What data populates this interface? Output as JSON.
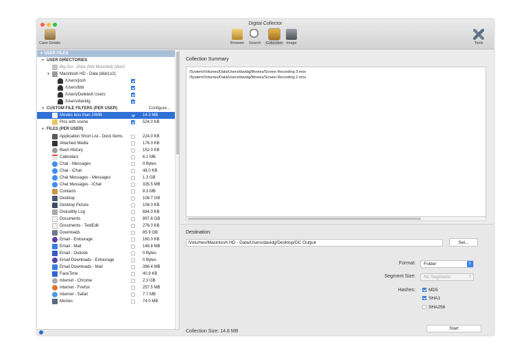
{
  "window": {
    "title": "Digital Collector"
  },
  "toolbar": {
    "case_details": "Case Details",
    "browser": "Browser",
    "search": "Search",
    "collection": "Collection",
    "image": "Image",
    "tools": "Tools"
  },
  "sidebar": {
    "user_files_header": "USER FILES",
    "user_directories": "USER DIRECTORIES",
    "big_sur": "Big Sur - Data (Not Mounted) (disk1",
    "macintosh_hd": "Macintosh HD - Data (disk1s2)",
    "dirs": [
      "/Users/josh",
      "/Users/bbt",
      "/Users/Deleted\\ Users",
      "/Users/davidg"
    ],
    "custom_filters": "CUSTOM FILE FILTERS (PER USER)",
    "configure": "Configure...",
    "filters": [
      {
        "name": "Movies less than 20MB",
        "size": "14.3 MB"
      },
      {
        "name": "Pics with scene",
        "size": "524.0 KB"
      }
    ],
    "files_per_user": "FILES (PER USER)",
    "files": [
      {
        "name": "Application Short List - Dock Items",
        "size": "224.0 KB"
      },
      {
        "name": "Attached Media",
        "size": "176.0 KB"
      },
      {
        "name": "Bash History",
        "size": "152.0 KB"
      },
      {
        "name": "Calendars",
        "size": "6.1 MB"
      },
      {
        "name": "Chat - Messages",
        "size": "0 Bytes"
      },
      {
        "name": "Chat - iChat",
        "size": "48.0 KB"
      },
      {
        "name": "Chat Messages - Messages",
        "size": "1.3 GB"
      },
      {
        "name": "Chat Messages - iChat",
        "size": "335.5 MB"
      },
      {
        "name": "Contacts",
        "size": "8.3 MB"
      },
      {
        "name": "Desktop",
        "size": "106.7 GB"
      },
      {
        "name": "Desktop Picture",
        "size": "108.0 KB"
      },
      {
        "name": "Diskutility Log",
        "size": "684.0 KB"
      },
      {
        "name": "Documents",
        "size": "897.6 GB"
      },
      {
        "name": "Documents - TextEdit",
        "size": "276.0 KB"
      },
      {
        "name": "Downloads",
        "size": "85.9 GB"
      },
      {
        "name": "Email - Entourage",
        "size": "160.0 KB"
      },
      {
        "name": "Email - Mail",
        "size": "148.6 MB"
      },
      {
        "name": "Email - Outlook",
        "size": "0 Bytes"
      },
      {
        "name": "Email Downloads - Entourage",
        "size": "0 Bytes"
      },
      {
        "name": "Email Downloads - Mail",
        "size": "396.4 MB"
      },
      {
        "name": "FaceTime",
        "size": "40.9 KB"
      },
      {
        "name": "Internet - Chrome",
        "size": "2.3 GB"
      },
      {
        "name": "Internet - Firefox",
        "size": "257.5 MB"
      },
      {
        "name": "Internet - Safari",
        "size": "7.7 MB"
      },
      {
        "name": "Movies",
        "size": "74.0 MB"
      }
    ]
  },
  "main": {
    "summary_title": "Collection Summary",
    "summary_lines": [
      "/System/Volumes/Data/Users/davidg/Movies/Screen Recording 3.mov",
      "/System/Volumes/Data/Users/davidg/Movies/Screen Recording 2.mov"
    ],
    "destination_label": "Destination:",
    "destination_value": "/Volumes/Macintosh HD - Data/Users/davidg/Desktop/DC Output",
    "set_button": "Set...",
    "format_label": "Format:",
    "format_value": "Folder",
    "segment_label": "Segment Size:",
    "segment_value": "No Segments",
    "hashes_label": "Hashes:",
    "hashes": [
      {
        "name": "MD5",
        "checked": true
      },
      {
        "name": "SHA1",
        "checked": true
      },
      {
        "name": "SHA256",
        "checked": false
      }
    ],
    "collection_size": "Collection Size: 14.8 MB",
    "start_button": "Start"
  }
}
